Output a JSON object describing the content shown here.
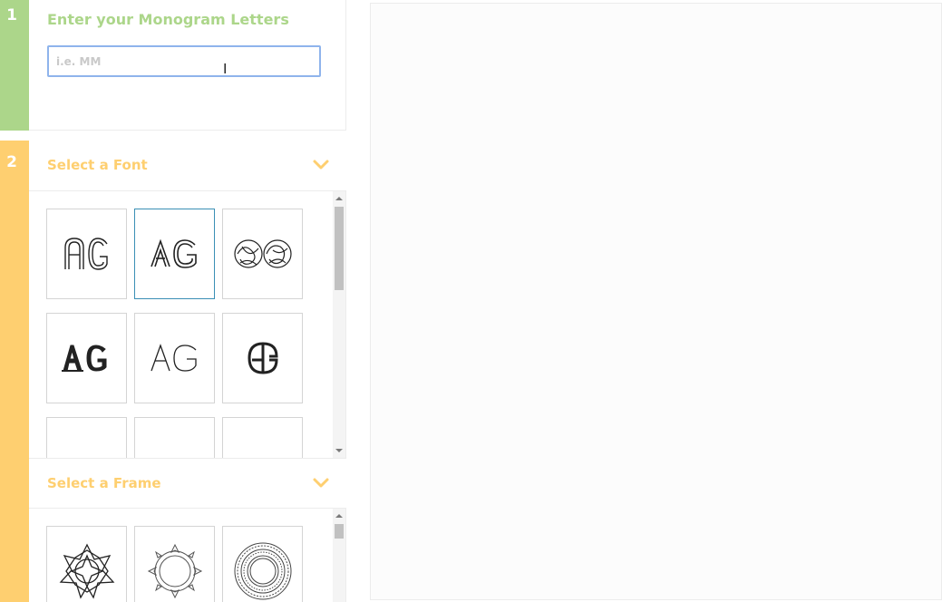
{
  "step1": {
    "number": "1",
    "title": "Enter your Monogram Letters",
    "input_placeholder": "i.e. MM",
    "input_value": "",
    "bar_color": "#acd68a"
  },
  "step2": {
    "number": "2",
    "bar_color": "#fecf70",
    "font_section": {
      "title": "Select a Font",
      "expand_icon": "chevron-down-icon",
      "tiles": [
        {
          "text": "AG",
          "style": "striped-sans"
        },
        {
          "text": "AG",
          "style": "outline-sans",
          "selected": true
        },
        {
          "text": "",
          "style": "ornate-circles"
        },
        {
          "text": "AG",
          "style": "blackletter"
        },
        {
          "text": "AG",
          "style": "thin-sans"
        },
        {
          "text": "AG",
          "style": "circle-monogram"
        },
        {
          "text": "",
          "style": "partial"
        },
        {
          "text": "",
          "style": "partial"
        },
        {
          "text": "",
          "style": "partial"
        }
      ]
    },
    "frame_section": {
      "title": "Select a Frame",
      "expand_icon": "chevron-down-icon",
      "tiles": [
        {
          "style": "geometric-star-frame"
        },
        {
          "style": "floral-wreath-frame"
        },
        {
          "style": "lace-circle-frame"
        }
      ]
    }
  },
  "preview": {}
}
